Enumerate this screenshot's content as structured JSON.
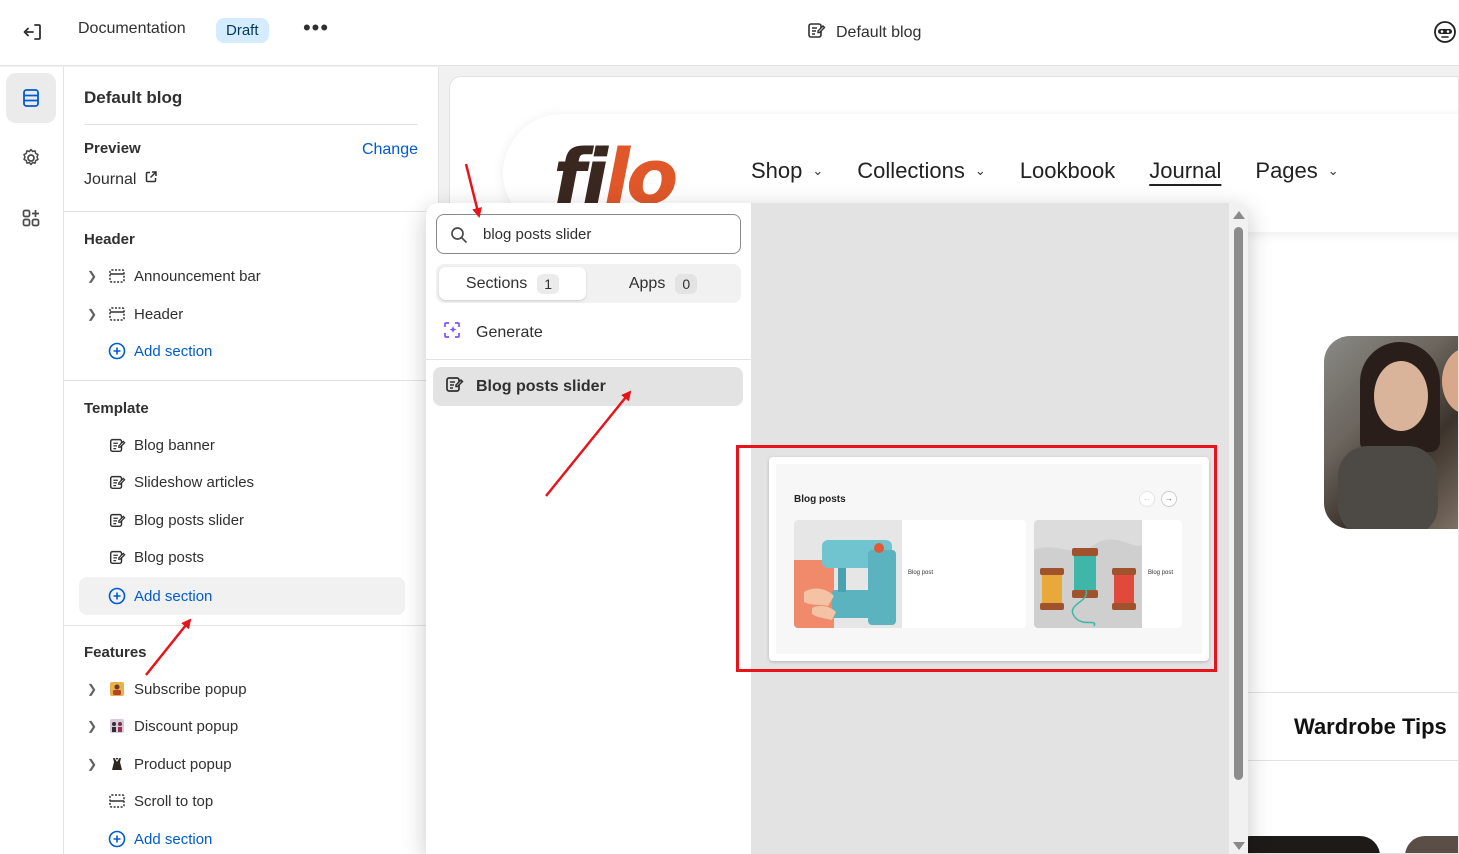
{
  "topbar": {
    "store_title": "Documentation",
    "status_badge": "Draft",
    "more_label": "•••",
    "template_title": "Default blog"
  },
  "sidebar": {
    "title": "Default blog",
    "preview_label": "Preview",
    "change_label": "Change",
    "preview_value": "Journal",
    "header_group": {
      "title": "Header",
      "items": [
        {
          "label": "Announcement bar",
          "icon": "section-layout-icon"
        },
        {
          "label": "Header",
          "icon": "section-layout-icon"
        }
      ],
      "add_label": "Add section"
    },
    "template_group": {
      "title": "Template",
      "items": [
        {
          "label": "Blog banner",
          "icon": "blog-post-icon"
        },
        {
          "label": "Slideshow articles",
          "icon": "blog-post-icon"
        },
        {
          "label": "Blog posts slider",
          "icon": "blog-post-icon"
        },
        {
          "label": "Blog posts",
          "icon": "blog-post-icon"
        }
      ],
      "add_label": "Add section"
    },
    "features_group": {
      "title": "Features",
      "items": [
        {
          "label": "Subscribe popup",
          "icon": "app-image-icon"
        },
        {
          "label": "Discount popup",
          "icon": "app-image-icon"
        },
        {
          "label": "Product popup",
          "icon": "app-image-icon"
        },
        {
          "label": "Scroll to top",
          "icon": "section-layout-icon"
        }
      ],
      "add_label": "Add section"
    }
  },
  "store_preview": {
    "logo_f": "fi",
    "logo_o": "lo",
    "nav": [
      {
        "label": "Shop",
        "has_dropdown": true
      },
      {
        "label": "Collections",
        "has_dropdown": true
      },
      {
        "label": "Lookbook",
        "has_dropdown": false
      },
      {
        "label": "Journal",
        "has_dropdown": false,
        "current": true
      },
      {
        "label": "Pages",
        "has_dropdown": true
      }
    ],
    "section_heading": "Wardrobe Tips"
  },
  "popover": {
    "search_value": "blog posts slider",
    "tabs": [
      {
        "label": "Sections",
        "count": "1",
        "active": true
      },
      {
        "label": "Apps",
        "count": "0",
        "active": false
      }
    ],
    "generate_label": "Generate",
    "result_label": "Blog posts slider",
    "preview": {
      "heading": "Blog posts",
      "post_labels": [
        "Blog post",
        "Blog post"
      ],
      "prev_arrow": "←",
      "next_arrow": "→"
    }
  },
  "colors": {
    "accent_link": "#005bd3",
    "annotation_red": "#e8141b",
    "logo_orange": "#e0582a",
    "logo_dark": "#3a2820"
  }
}
